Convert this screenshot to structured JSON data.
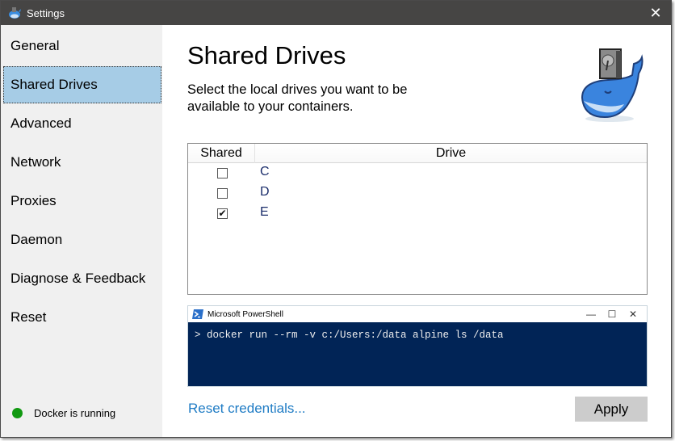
{
  "window": {
    "title": "Settings",
    "close_glyph": "✕"
  },
  "sidebar": {
    "items": [
      {
        "label": "General",
        "selected": false
      },
      {
        "label": "Shared Drives",
        "selected": true
      },
      {
        "label": "Advanced",
        "selected": false
      },
      {
        "label": "Network",
        "selected": false
      },
      {
        "label": "Proxies",
        "selected": false
      },
      {
        "label": "Daemon",
        "selected": false
      },
      {
        "label": "Diagnose & Feedback",
        "selected": false
      },
      {
        "label": "Reset",
        "selected": false
      }
    ],
    "status": {
      "text": "Docker is running",
      "color": "#119911"
    }
  },
  "main": {
    "title": "Shared Drives",
    "description": "Select the local drives you want to be available to your containers.",
    "table": {
      "columns": [
        "Shared",
        "Drive"
      ],
      "rows": [
        {
          "drive": "C",
          "shared": false
        },
        {
          "drive": "D",
          "shared": false
        },
        {
          "drive": "E",
          "shared": true
        }
      ]
    },
    "powershell": {
      "title": "Microsoft PowerShell",
      "controls": [
        "—",
        "☐",
        "✕"
      ],
      "command": "> docker run --rm -v c:/Users:/data alpine ls /data"
    },
    "reset_credentials_label": "Reset credentials...",
    "apply_label": "Apply"
  },
  "colors": {
    "titlebar": "#464544",
    "selected_nav": "#a6cce6",
    "link": "#1e7bc4",
    "powershell_bg": "#012456"
  }
}
